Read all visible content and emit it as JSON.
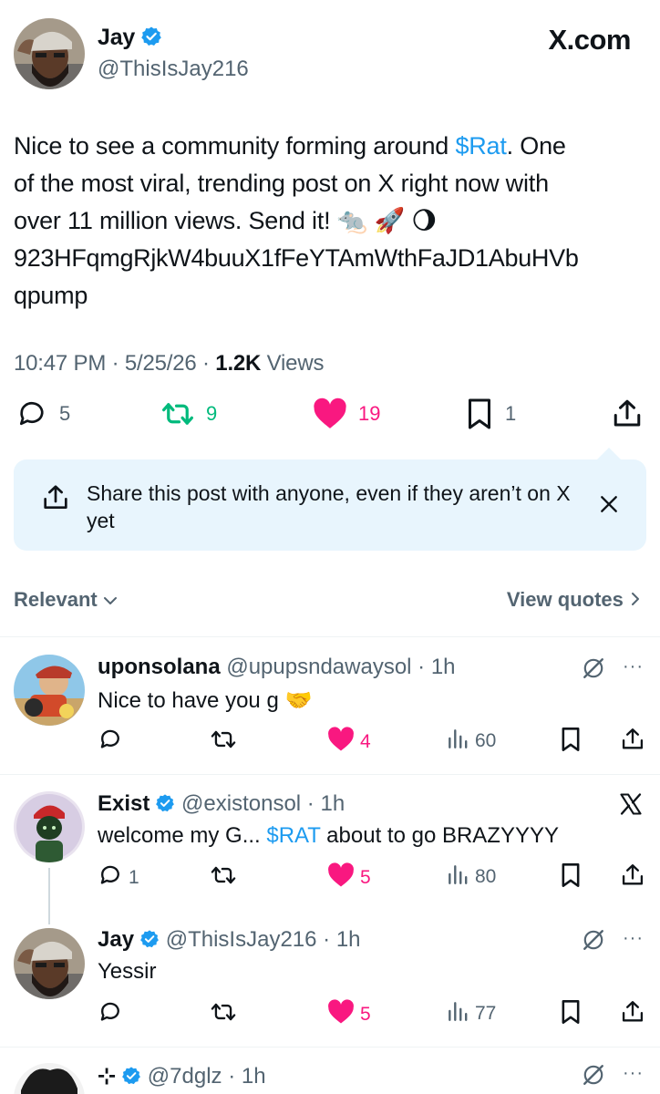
{
  "post": {
    "author_name": "Jay",
    "author_handle": "@ThisIsJay216",
    "site_logo": "X.com",
    "text_line1_a": "Nice to see a community forming around ",
    "text_ticker": "$Rat",
    "text_line1_b": ". One",
    "text_line2": "of the most viral, trending post on X right now with",
    "text_line3": "over 11 million views. Send it!",
    "emoji": "🐀 🚀 🌖",
    "address_line1": "923HFqmgRjkW4buuX1fFeYTAmWthFaJD1AbuHVb",
    "address_line2": "qpump",
    "time": "10:47 PM",
    "date": "5/25/26",
    "views_count": "1.2K",
    "views_label": "Views",
    "replies": "5",
    "reposts": "9",
    "likes": "19",
    "bookmarks": "1"
  },
  "share_banner": {
    "text": "Share this post with anyone, even if they aren’t on X yet"
  },
  "sort": {
    "label": "Relevant",
    "view_quotes": "View quotes"
  },
  "replies": [
    {
      "name": "uponsolana",
      "handle": "@upupsndawaysol",
      "time": "1h",
      "text": "Nice to have you g",
      "emoji": "🤝",
      "replies": "",
      "likes": "4",
      "views": "60"
    },
    {
      "name": "Exist",
      "handle": "@existonsol",
      "time": "1h",
      "text_a": "welcome my G... ",
      "ticker": "$RAT",
      "text_b": " about to go BRAZYYYY",
      "replies": "1",
      "likes": "5",
      "views": "80"
    },
    {
      "name": "Jay",
      "handle": "@ThisIsJay216",
      "time": "1h",
      "text": "Yessir",
      "replies": "",
      "likes": "5",
      "views": "77"
    },
    {
      "name": "⊹",
      "handle": "@7dglz",
      "time": "1h"
    }
  ],
  "colors": {
    "accent": "#1d9bf0",
    "like": "#f91880",
    "repost": "#00ba7c",
    "muted": "#536471",
    "banner": "#e8f5fd"
  }
}
